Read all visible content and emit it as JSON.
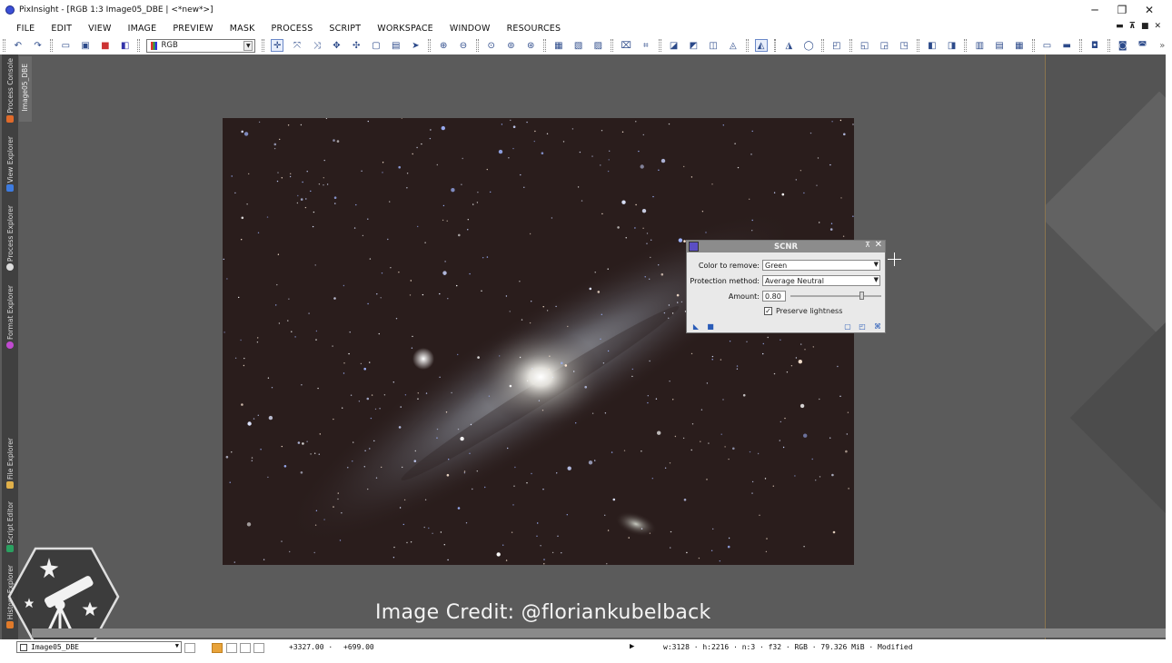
{
  "window": {
    "title": "PixInsight - [RGB 1:3 Image05_DBE | <*new*>]",
    "controls": [
      "─",
      "❐",
      "✕"
    ]
  },
  "menu": {
    "items": [
      "FILE",
      "EDIT",
      "VIEW",
      "IMAGE",
      "PREVIEW",
      "MASK",
      "PROCESS",
      "SCRIPT",
      "WORKSPACE",
      "WINDOW",
      "RESOURCES"
    ]
  },
  "toolbar": {
    "channel_value": "RGB"
  },
  "side_tabs": {
    "process_console": "Process Console",
    "view_explorer": "View Explorer",
    "process_explorer": "Process Explorer",
    "format_explorer": "Format Explorer",
    "file_explorer": "File Explorer",
    "script_editor": "Script Editor",
    "history_explorer": "History Explorer",
    "document_tab": "Image05_DBE"
  },
  "scnr": {
    "title": "SCNR",
    "color_label": "Color to remove:",
    "color_value": "Green",
    "protection_label": "Protection method:",
    "protection_value": "Average Neutral",
    "amount_label": "Amount:",
    "amount_value": "0.80",
    "amount_fraction": 0.8,
    "preserve_label": "Preserve lightness",
    "preserve_checked": true
  },
  "overlay": {
    "credit": "Image Credit: @floriankubelback"
  },
  "statusbar": {
    "view_name": "Image05_DBE",
    "coord_x": "+3327.00 ·",
    "coord_y": "+699.00",
    "info": "w:3128 · h:2216 · n:3 · f32 · RGB · 79.326 MiB · Modified"
  },
  "colors": {
    "workspace": "#5b5b5b",
    "sky": "#2a1d1c",
    "dialog_header": "#8c8c8c",
    "accent_blue": "#2a5cb8"
  }
}
